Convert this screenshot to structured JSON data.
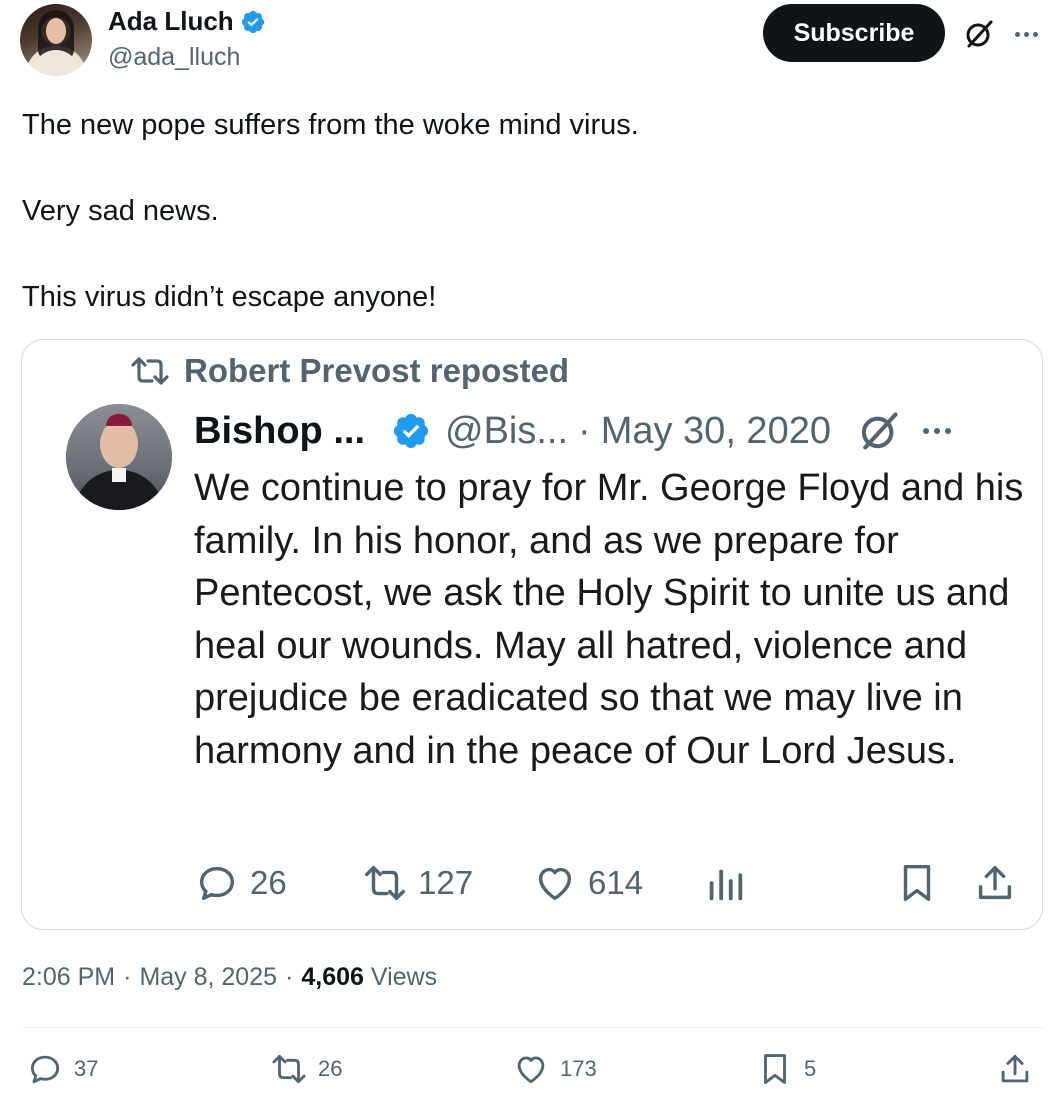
{
  "author": {
    "display_name": "Ada Lluch",
    "handle": "@ada_lluch",
    "verified": true
  },
  "header": {
    "subscribe_label": "Subscribe"
  },
  "tweet": {
    "lines": [
      "The new pope suffers from the woke mind virus.",
      "Very sad news.",
      "This virus didn’t escape anyone!"
    ]
  },
  "quote": {
    "repost_text": "Robert Prevost reposted",
    "name": "Bishop ...",
    "handle": "@Bis...",
    "separator": "·",
    "date": "May 30, 2020",
    "text": "We continue to pray for Mr. George Floyd and his family. In his honor, and as we prepare for Pentecost, we ask the Holy Spirit to unite us and heal our wounds. May all hatred, violence and prejudice be eradicated so that we may live in harmony and in the peace of Our Lord Jesus.",
    "replies": "26",
    "reposts": "127",
    "likes": "614"
  },
  "meta": {
    "time": "2:06 PM",
    "dot1": "·",
    "date": "May 8, 2025",
    "dot2": "·",
    "views_count": "4,606",
    "views_label": "Views"
  },
  "actions": {
    "replies": "37",
    "reposts": "26",
    "likes": "173",
    "bookmarks": "5"
  },
  "colors": {
    "verified_blue": "#1d9bf0",
    "text_primary": "#0f1419",
    "text_secondary": "#536471",
    "border": "#cfd9de"
  }
}
